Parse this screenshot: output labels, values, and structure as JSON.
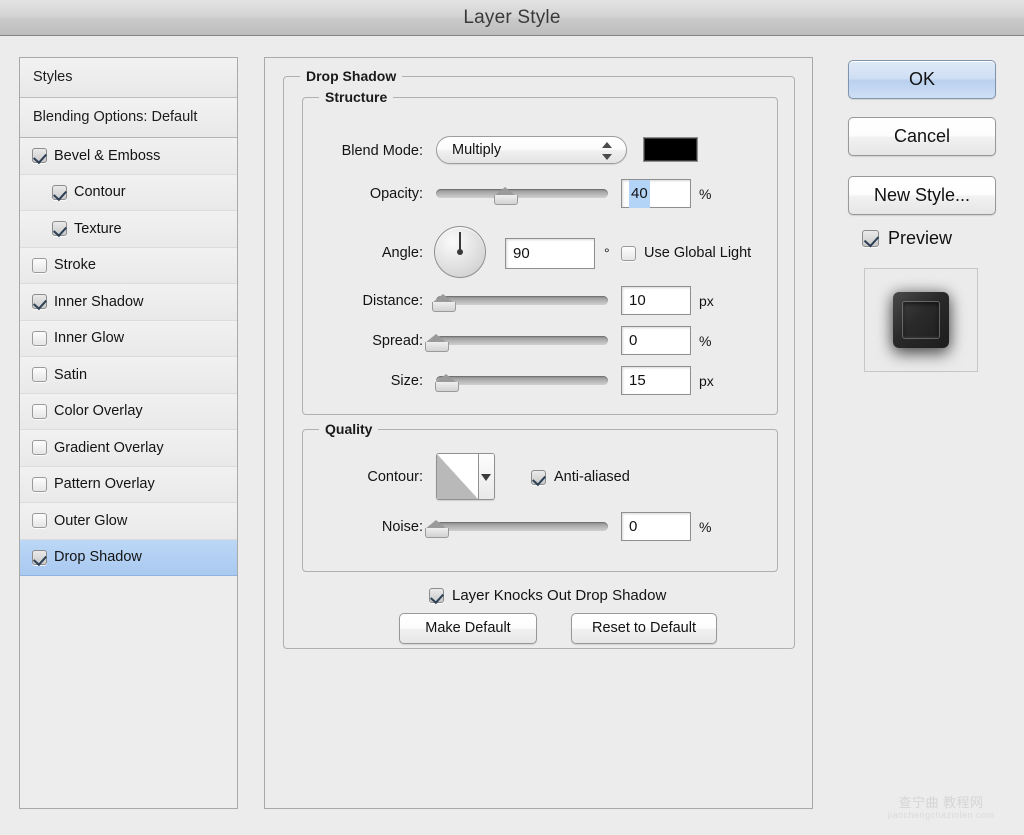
{
  "window": {
    "title": "Layer Style"
  },
  "sidebar": {
    "styles_label": "Styles",
    "blending_label": "Blending Options: Default",
    "effects": [
      {
        "label": "Bevel & Emboss",
        "checked": true,
        "indent": false,
        "selected": false
      },
      {
        "label": "Contour",
        "checked": true,
        "indent": true,
        "selected": false
      },
      {
        "label": "Texture",
        "checked": true,
        "indent": true,
        "selected": false
      },
      {
        "label": "Stroke",
        "checked": false,
        "indent": false,
        "selected": false
      },
      {
        "label": "Inner Shadow",
        "checked": true,
        "indent": false,
        "selected": false
      },
      {
        "label": "Inner Glow",
        "checked": false,
        "indent": false,
        "selected": false
      },
      {
        "label": "Satin",
        "checked": false,
        "indent": false,
        "selected": false
      },
      {
        "label": "Color Overlay",
        "checked": false,
        "indent": false,
        "selected": false
      },
      {
        "label": "Gradient Overlay",
        "checked": false,
        "indent": false,
        "selected": false
      },
      {
        "label": "Pattern Overlay",
        "checked": false,
        "indent": false,
        "selected": false
      },
      {
        "label": "Outer Glow",
        "checked": false,
        "indent": false,
        "selected": false
      },
      {
        "label": "Drop Shadow",
        "checked": true,
        "indent": false,
        "selected": true
      }
    ]
  },
  "main": {
    "group_title": "Drop Shadow",
    "structure": {
      "title": "Structure",
      "blend_mode_label": "Blend Mode:",
      "blend_mode_value": "Multiply",
      "shadow_color": "#000000",
      "opacity_label": "Opacity:",
      "opacity_value": "40",
      "opacity_unit": "%",
      "opacity_percent": 40,
      "angle_label": "Angle:",
      "angle_value": "90",
      "angle_unit": "°",
      "use_global_light_label": "Use Global Light",
      "use_global_light_checked": false,
      "distance_label": "Distance:",
      "distance_value": "10",
      "distance_unit": "px",
      "distance_percent": 4,
      "spread_label": "Spread:",
      "spread_value": "0",
      "spread_unit": "%",
      "spread_percent": 0,
      "size_label": "Size:",
      "size_value": "15",
      "size_unit": "px",
      "size_percent": 6
    },
    "quality": {
      "title": "Quality",
      "contour_label": "Contour:",
      "anti_aliased_label": "Anti-aliased",
      "anti_aliased_checked": true,
      "noise_label": "Noise:",
      "noise_value": "0",
      "noise_unit": "%",
      "noise_percent": 0
    },
    "knockout_label": "Layer Knocks Out Drop Shadow",
    "knockout_checked": true,
    "make_default_label": "Make Default",
    "reset_default_label": "Reset to Default"
  },
  "actions": {
    "ok_label": "OK",
    "cancel_label": "Cancel",
    "new_style_label": "New Style...",
    "preview_label": "Preview",
    "preview_checked": true
  },
  "watermark": {
    "line1": "查宁曲 教程网",
    "line2": "jiaochengchaziolen com"
  },
  "colors": {
    "window_bg": "#ececec",
    "selection_blue": "#aecdf2",
    "field_selection": "#b4d4f7",
    "border": "#a9a9a9"
  }
}
